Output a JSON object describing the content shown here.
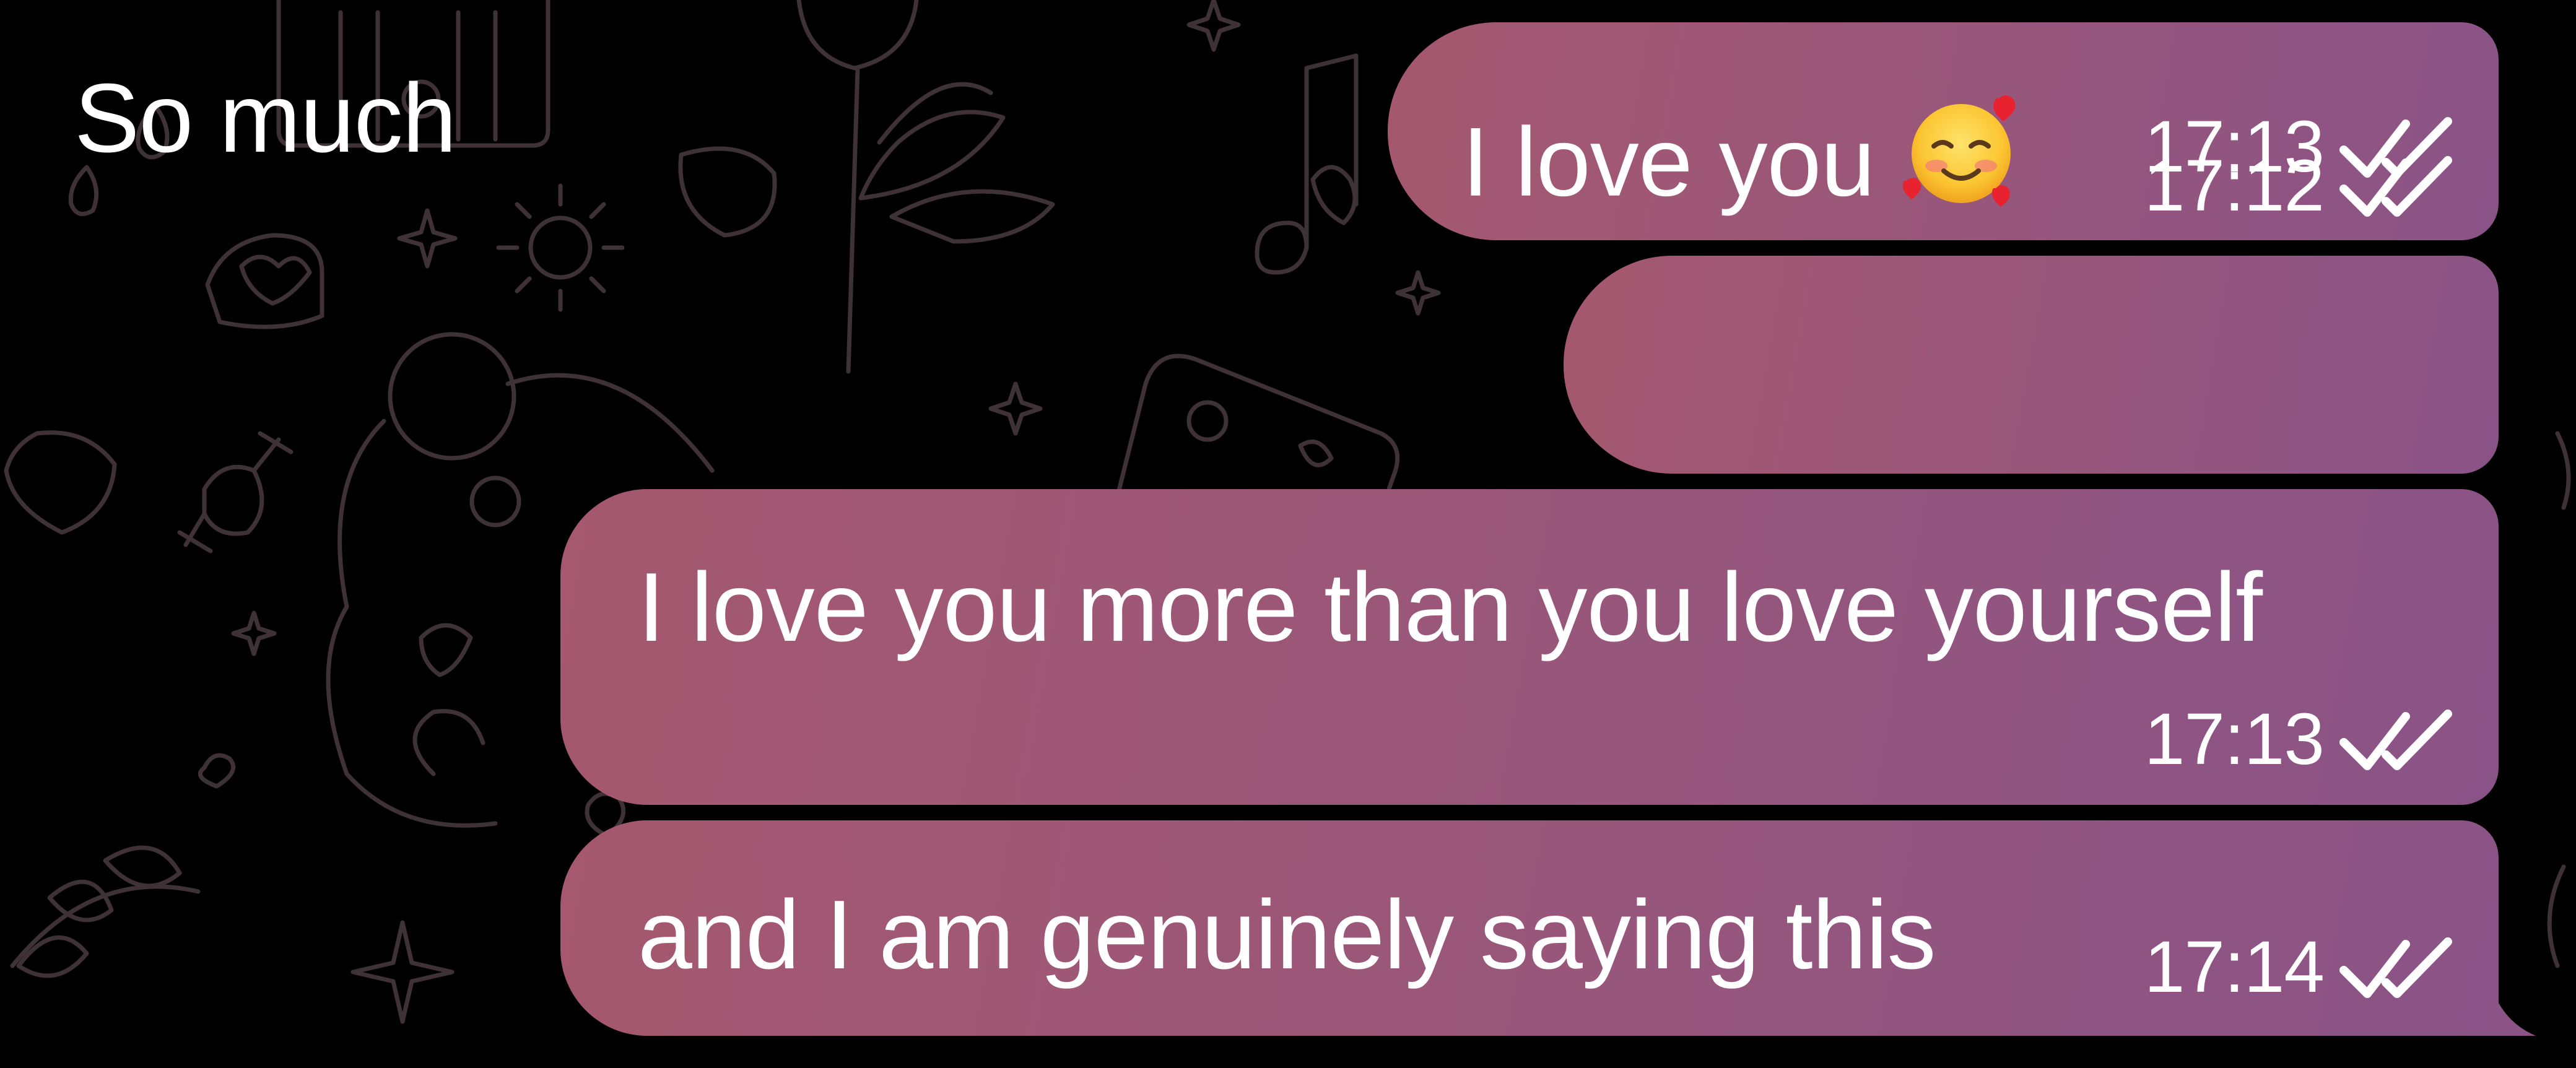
{
  "messages": [
    {
      "text": "I love you",
      "emoji": "smiling-face-with-hearts",
      "time": "17:12",
      "status": "read"
    },
    {
      "text": "So much",
      "time": "17:13",
      "status": "read"
    },
    {
      "text": "I love you more than you love yourself",
      "time": "17:13",
      "status": "read"
    },
    {
      "text": "and I am genuinely saying this",
      "time": "17:14",
      "status": "read"
    }
  ],
  "colors": {
    "background": "#000000",
    "bubble_gradient_start": "#a5586f",
    "bubble_gradient_end": "#8a5387",
    "text": "#ffffff",
    "doodle_stroke": "#3e3236"
  },
  "icons": {
    "read_receipt": "double-check-icon",
    "emoji": "smiling-face-with-hearts-icon"
  }
}
